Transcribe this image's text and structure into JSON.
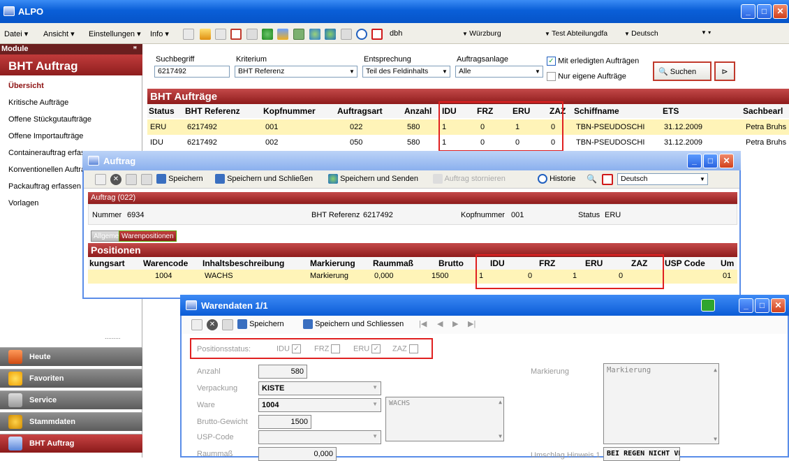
{
  "app": {
    "title": "ALPO"
  },
  "menu": {
    "items": [
      "Datei ▾",
      "Ansicht ▾",
      "Einstellungen ▾",
      "Info ▾"
    ],
    "dbh": "dbh",
    "location": "Würzburg",
    "dept": "Test Abteilungdfa",
    "lang": "Deutsch"
  },
  "sidebar": {
    "header": "Module",
    "title": "BHT Auftrag",
    "items": [
      "Übersicht",
      "Kritische Aufträge",
      "Offene Stückgutaufträge",
      "Offene Importaufträge",
      "Containerauftrag erfassen",
      "Konventionellen Auftrag",
      "Packauftrag erfassen",
      "Vorlagen"
    ],
    "buttons": [
      "Heute",
      "Favoriten",
      "Service",
      "Stammdaten",
      "BHT Auftrag"
    ],
    "grip": "........."
  },
  "search": {
    "suchbegriff_label": "Suchbegriff",
    "suchbegriff": "6217492",
    "kriterium_label": "Kriterium",
    "kriterium": "BHT Referenz",
    "entsprechung_label": "Entsprechung",
    "entsprechung": "Teil des Feldinhalts",
    "auftragsanlage_label": "Auftragsanlage",
    "auftragsanlage": "Alle",
    "chk1": "Mit erledigten Aufträgen",
    "chk2": "Nur eigene Aufträge",
    "suchen": "Suchen"
  },
  "grid": {
    "title": "BHT Aufträge",
    "columns": [
      "Status",
      "BHT Referenz",
      "Kopfnummer",
      "Auftragsart",
      "Anzahl",
      "IDU",
      "FRZ",
      "ERU",
      "ZAZ",
      "Schiffname",
      "ETS",
      "Sachbearl"
    ],
    "rows": [
      [
        "ERU",
        "6217492",
        "001",
        "022",
        "580",
        "1",
        "0",
        "1",
        "0",
        "TBN-PSEUDOSCHI",
        "31.12.2009",
        "Petra Bruhs"
      ],
      [
        "IDU",
        "6217492",
        "002",
        "050",
        "580",
        "1",
        "0",
        "0",
        "0",
        "TBN-PSEUDOSCHI",
        "31.12.2009",
        "Petra Bruhs"
      ]
    ]
  },
  "auftrag": {
    "title": "Auftrag",
    "toolbar": {
      "save": "Speichern",
      "save_close": "Speichern und Schließen",
      "save_send": "Speichern und Senden",
      "cancel": "Auftrag stornieren",
      "history": "Historie",
      "lang": "Deutsch"
    },
    "header": "Auftrag (022)",
    "nummer_label": "Nummer",
    "nummer": "6934",
    "bht_label": "BHT Referenz",
    "bht": "6217492",
    "kopf_label": "Kopfnummer",
    "kopf": "001",
    "status_label": "Status",
    "status": "ERU",
    "tabs": [
      "Allgemein",
      "Warenpositionen"
    ],
    "pos_title": "Positionen",
    "pos_columns": [
      "kungsart",
      "Warencode",
      "Inhaltsbeschreibung",
      "Markierung",
      "Raummaß",
      "Brutto",
      "IDU",
      "FRZ",
      "ERU",
      "ZAZ",
      "USP Code",
      "Um"
    ],
    "pos_row": [
      "",
      "1004",
      "WACHS",
      "Markierung",
      "0,000",
      "1500",
      "1",
      "0",
      "1",
      "0",
      "",
      "01"
    ]
  },
  "waren": {
    "title": "Warendaten 1/1",
    "toolbar": {
      "save": "Speichern",
      "save_close": "Speichern und Schliessen"
    },
    "positionsstatus_label": "Positionsstatus:",
    "status": [
      {
        "label": "IDU",
        "checked": true
      },
      {
        "label": "FRZ",
        "checked": false
      },
      {
        "label": "ERU",
        "checked": true
      },
      {
        "label": "ZAZ",
        "checked": false
      }
    ],
    "anzahl_label": "Anzahl",
    "anzahl": "580",
    "verpackung_label": "Verpackung",
    "verpackung": "KISTE",
    "ware_label": "Ware",
    "ware": "1004",
    "ware_desc": "WACHS",
    "brutto_label": "Brutto-Gewicht",
    "brutto": "1500",
    "usp_label": "USP-Code",
    "usp": "",
    "raum_label": "Raummaß",
    "raum": "0,000",
    "markierung_label": "Markierung",
    "markierung": "Markierung",
    "umschlag_label": "Umschlag Hinweis 1",
    "umschlag": "BEI REGEN NICHT VERLA"
  },
  "colors": {
    "accent": "#8e1e1e",
    "title": "#0a5fd8",
    "highlight": "#e02020"
  }
}
